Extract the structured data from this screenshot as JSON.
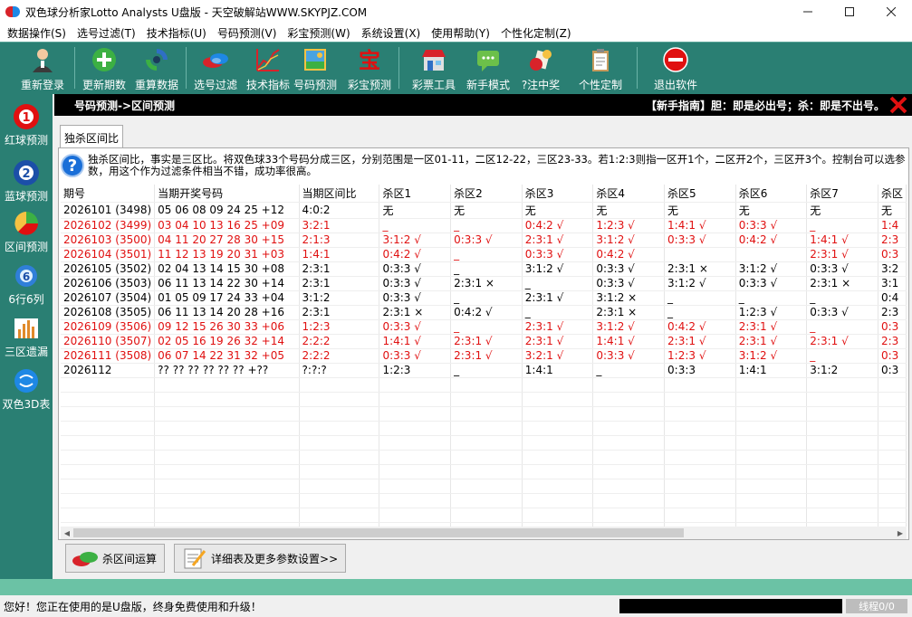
{
  "window": {
    "title": "双色球分析家Lotto Analysts U盘版 - 天空破解站WWW.SKYPJZ.COM"
  },
  "menu": [
    "数据操作(S)",
    "选号过滤(T)",
    "技术指标(U)",
    "号码预测(V)",
    "彩宝预测(W)",
    "系统设置(X)",
    "使用帮助(Y)",
    "个性化定制(Z)"
  ],
  "toolbar": {
    "relogin": "重新登录",
    "update": "更新期数",
    "recalc": "重算数据",
    "filter": "选号过滤",
    "tech": "技术指标",
    "predict": "号码预测",
    "caibao": "彩宝预测",
    "tools": "彩票工具",
    "newbie": "新手模式",
    "prize": "?注中奖",
    "custom": "个性定制",
    "exit": "退出软件"
  },
  "sidebar": {
    "red": "红球预测",
    "blue": "蓝球预测",
    "zone": "区间预测",
    "six": "6行6列",
    "miss": "三区遗漏",
    "threed": "双色3D表"
  },
  "sidebar_icons": {
    "red_num": "1",
    "blue_num": "2",
    "six_num": "6"
  },
  "panel": {
    "breadcrumb": "号码预测->区间预测",
    "guide": "【新手指南】胆：即是必出号；杀：即是不出号。",
    "tab": "独杀区间比",
    "note": "独杀区间比，事实是三区比。将双色球33个号码分成三区，分别范围是一区01-11，二区12-22，三区23-33。若1:2:3则指一区开1个，二区开2个，三区开3个。控制台可以选参数，用这个作为过滤条件相当不错，成功率很高。"
  },
  "table": {
    "headers": [
      "期号",
      "当期开奖号码",
      "当期区间比",
      "杀区1",
      "杀区2",
      "杀区3",
      "杀区4",
      "杀区5",
      "杀区6",
      "杀区7",
      "杀区"
    ],
    "rows": [
      {
        "red": false,
        "cells": [
          "2026101 (3498)",
          "05 06 08 09 24 25 +12",
          "4:0:2",
          "无",
          "无",
          "无",
          "无",
          "无",
          "无",
          "无",
          "无"
        ]
      },
      {
        "red": true,
        "cells": [
          "2026102 (3499)",
          "03 04 10 13 16 25 +09",
          "3:2:1",
          "_",
          "_",
          "0:4:2 √",
          "1:2:3 √",
          "1:4:1 √",
          "0:3:3 √",
          "_",
          "1:4"
        ]
      },
      {
        "red": true,
        "cells": [
          "2026103 (3500)",
          "04 11 20 27 28 30 +15",
          "2:1:3",
          "3:1:2 √",
          "0:3:3 √",
          "2:3:1 √",
          "3:1:2 √",
          "0:3:3 √",
          "0:4:2 √",
          "1:4:1 √",
          "2:3"
        ]
      },
      {
        "red": true,
        "cells": [
          "2026104 (3501)",
          "11 12 13 19 20 31 +03",
          "1:4:1",
          "0:4:2 √",
          "_",
          "0:3:3 √",
          "0:4:2 √",
          "",
          "",
          "2:3:1 √",
          "0:3"
        ]
      },
      {
        "red": false,
        "cells": [
          "2026105 (3502)",
          "02 04 13 14 15 30 +08",
          "2:3:1",
          "0:3:3 √",
          "_",
          "3:1:2 √",
          "0:3:3 √",
          "2:3:1 ×",
          "3:1:2 √",
          "0:3:3 √",
          "3:2"
        ]
      },
      {
        "red": false,
        "cells": [
          "2026106 (3503)",
          "06 11 13 14 22 30 +14",
          "2:3:1",
          "0:3:3 √",
          "2:3:1 ×",
          "_",
          "0:3:3 √",
          "3:1:2 √",
          "0:3:3 √",
          "2:3:1 ×",
          "3:1"
        ]
      },
      {
        "red": false,
        "cells": [
          "2026107 (3504)",
          "01 05 09 17 24 33 +04",
          "3:1:2",
          "0:3:3 √",
          "_",
          "2:3:1 √",
          "3:1:2 ×",
          "_",
          "_",
          "_",
          "0:4"
        ]
      },
      {
        "red": false,
        "cells": [
          "2026108 (3505)",
          "06 11 13 14 20 28 +16",
          "2:3:1",
          "2:3:1 ×",
          "0:4:2 √",
          "_",
          "2:3:1 ×",
          "_",
          "1:2:3 √",
          "0:3:3 √",
          "2:3"
        ]
      },
      {
        "red": true,
        "cells": [
          "2026109 (3506)",
          "09 12 15 26 30 33 +06",
          "1:2:3",
          "0:3:3 √",
          "_",
          "2:3:1 √",
          "3:1:2 √",
          "0:4:2 √",
          "2:3:1 √",
          "_",
          "0:3"
        ]
      },
      {
        "red": true,
        "cells": [
          "2026110 (3507)",
          "02 05 16 19 26 32 +14",
          "2:2:2",
          "1:4:1 √",
          "2:3:1 √",
          "2:3:1 √",
          "1:4:1 √",
          "2:3:1 √",
          "2:3:1 √",
          "2:3:1 √",
          "2:3"
        ]
      },
      {
        "red": true,
        "cells": [
          "2026111 (3508)",
          "06 07 14 22 31 32 +05",
          "2:2:2",
          "0:3:3 √",
          "2:3:1 √",
          "3:2:1 √",
          "0:3:3 √",
          "1:2:3 √",
          "3:1:2 √",
          "_",
          "0:3"
        ]
      },
      {
        "red": false,
        "cells": [
          "2026112",
          "?? ?? ?? ?? ?? ?? +??",
          "?:?:?",
          "1:2:3",
          "_",
          "1:4:1",
          "_",
          "0:3:3",
          "1:4:1",
          "3:1:2",
          "0:3"
        ]
      }
    ]
  },
  "buttons": {
    "calc": "杀区间运算",
    "detail": "详细表及更多参数设置>>"
  },
  "status": {
    "message": "您好！您正在使用的是U盘版，终身免费使用和升级！",
    "threads": "线程0/0"
  }
}
